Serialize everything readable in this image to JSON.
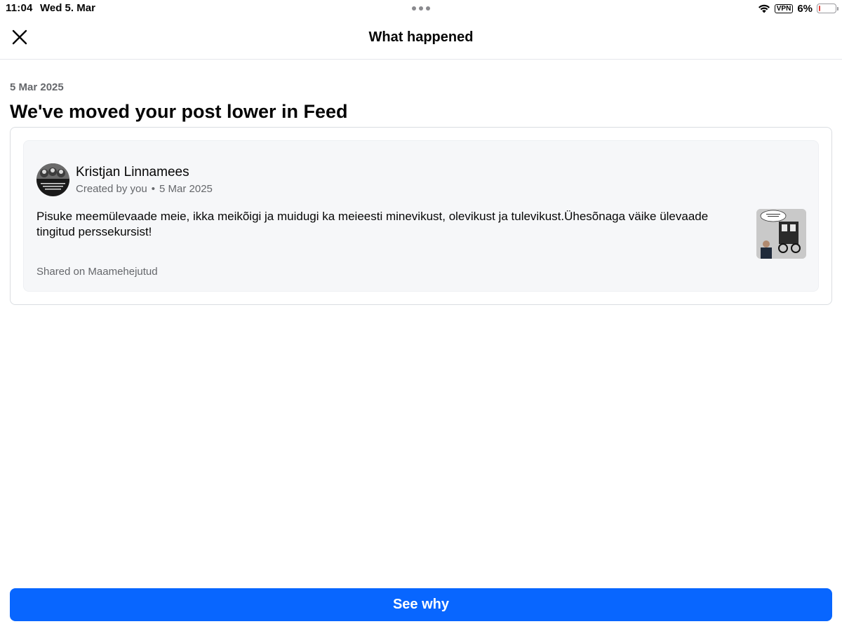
{
  "status_bar": {
    "time": "11:04",
    "date": "Wed 5. Mar",
    "vpn_label": "VPN",
    "battery_percent_label": "6%",
    "battery_level": 0.06,
    "battery_color": "#e5423b"
  },
  "header": {
    "title": "What happened",
    "close_icon": "close-icon"
  },
  "notice": {
    "date": "5 Mar 2025",
    "title": "We've moved your post lower in Feed"
  },
  "post": {
    "author": "Kristjan Linnamees",
    "created_by": "Created by you",
    "separator": "•",
    "date": "5 Mar 2025",
    "text": "Pisuke meemülevaade meie, ikka meikõigi ja muidugi ka meieesti minevikust, olevikust ja tulevikust.Ühesõnaga väike ülevaade tingitud perssekursist!",
    "shared_on": "Shared on Maamehejutud"
  },
  "actions": {
    "see_why_label": "See why"
  },
  "colors": {
    "accent": "#0866ff",
    "secondary_text": "#65676b",
    "card_background": "#f6f7f9"
  }
}
